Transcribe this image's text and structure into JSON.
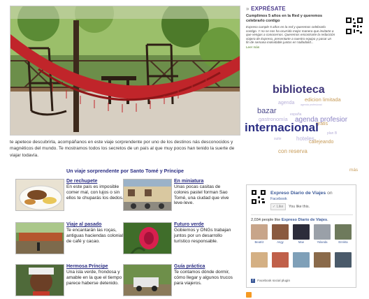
{
  "expresate": {
    "title": "EXPRÉSATE",
    "headline": "Cumplimos 5 años en la Red y queremos celebrarlo contigo",
    "body": "Expreso cumple 5 años en la red y queremos celebrarlo contigo. Y no se nos ha ocurrido mejor manera que invitarte a que vengas a conocernos. Queremos encontrarte la redacción viajera de Expreso, presentarte a nuestro equipo y pasar un fin de semana inolvidable juntos en Valladolid...",
    "more": "Leer más"
  },
  "tag_cloud": [
    {
      "text": "biblioteca",
      "color": "#3d3478"
    },
    {
      "text": "edicion limitada",
      "color": "#c79b58"
    },
    {
      "text": "agenda",
      "color": "#b6afd8"
    },
    {
      "text": "bazar",
      "color": "#4c4a8c"
    },
    {
      "text": "gastronomía",
      "color": "#b6afd8"
    },
    {
      "text": "agenda profesior",
      "color": "#8a82c4"
    },
    {
      "text": "internacional",
      "color": "#2b2e83"
    },
    {
      "text": "hoteles",
      "color": "#b6afd8"
    },
    {
      "text": "callejeando",
      "color": "#c79b58"
    },
    {
      "text": "con reserva",
      "color": "#c79b58"
    },
    {
      "text": "españa",
      "color": "#b6afd8"
    },
    {
      "text": "suite",
      "color": "#b6afd8"
    },
    {
      "text": "plan B",
      "color": "#b6afd8"
    },
    {
      "text": "gratis",
      "color": "#c79b58"
    },
    {
      "text": "agenda profesional",
      "color": "#b6afd8"
    }
  ],
  "intro": "te apetece descubrirla, acompáñanos en este viaje sorprendente por uno de los destinos nás desconocidos y magnéticos del mundo. Te mostramos todos los secretos de un país al que muy pocos han tenido la suerte de viajar todavía.",
  "section_title": "Un viaje sorprendente por Santo Tomé y Príncipe",
  "more_link": "más",
  "items": [
    {
      "title": "De rechupete",
      "desc": "En este país es imposible comer mal, con lujos o sin ellos te chuparás los dedos."
    },
    {
      "title": "En miniatura",
      "desc": "Unas pocas casitas de colores pastel forman Sao Tomé, una ciudad que vive leve-leve."
    },
    {
      "title": "Viaje al pasado",
      "desc": "Te encantarán las roças, antiguas haciendas coloniales de café y cacao."
    },
    {
      "title": "Futuro verde",
      "desc": "Gobiernos y ONGs trabajan juntos por un desarrollo turístico responsable."
    },
    {
      "title": "Hermosa Príncipe",
      "desc": "Una isla verde, frondosa y amable en la que el tiempo parece haberse detenido."
    },
    {
      "title": "Guía práctica",
      "desc": "Te contamos dónde dormir, cómo llegar y algunos trucos para viajeros."
    }
  ],
  "facebook": {
    "page_name": "Expreso Diario de Viajes",
    "on": "on",
    "site": "Facebook",
    "like_button": "Like",
    "you_like": "You like this.",
    "count_text": "2,034 people like",
    "count_page": "Expreso Diario de Viajes",
    "faces": [
      "Beatriz",
      "Angy",
      "Mae",
      "Yolanda",
      "Enriéta",
      "",
      "",
      "",
      "",
      ""
    ],
    "plugin": "Facebook social plugin"
  }
}
